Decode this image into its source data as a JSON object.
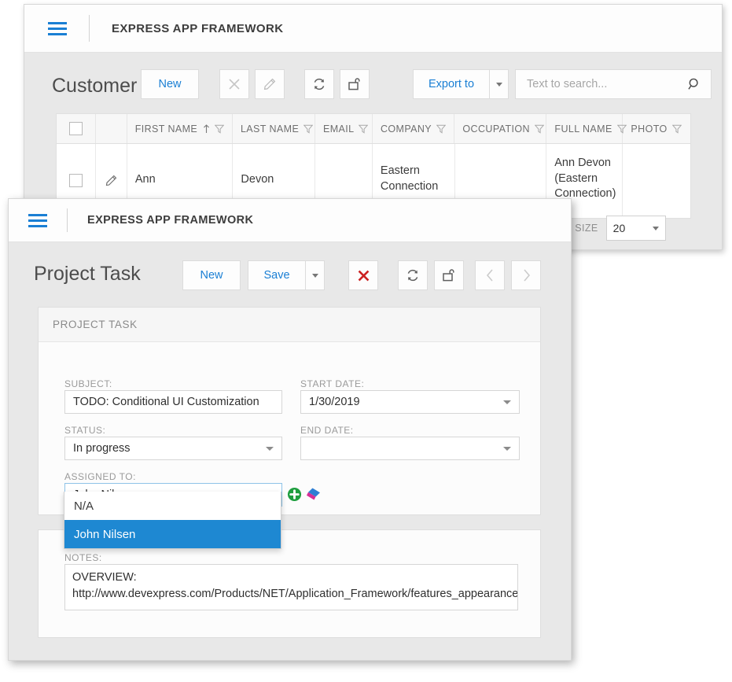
{
  "background_window": {
    "app_title": "EXPRESS APP FRAMEWORK",
    "menu_icon": "hamburger-icon",
    "page_title": "Customer",
    "toolbar": {
      "new_label": "New",
      "delete_icon": "close-x-icon",
      "edit_icon": "pencil-icon",
      "refresh_icon": "refresh-icon",
      "unlink_icon": "open-box-icon",
      "export_label": "Export to",
      "export_caret_icon": "chevron-down-icon",
      "search_placeholder": "Text to search...",
      "search_value": "",
      "search_icon": "magnifier-icon"
    },
    "grid": {
      "select_all_icon": "checkbox-icon",
      "columns": [
        {
          "label": "FIRST NAME",
          "sort": "asc",
          "sort_icon": "arrow-up-icon",
          "filter_icon": "funnel-icon"
        },
        {
          "label": "LAST NAME",
          "sort": "",
          "filter_icon": "funnel-icon"
        },
        {
          "label": "EMAIL",
          "sort": "",
          "filter_icon": "funnel-icon"
        },
        {
          "label": "COMPANY",
          "sort": "",
          "filter_icon": "funnel-icon"
        },
        {
          "label": "OCCUPATION",
          "sort": "",
          "filter_icon": "funnel-icon"
        },
        {
          "label": "FULL NAME",
          "sort": "",
          "filter_icon": "funnel-icon"
        },
        {
          "label": "PHOTO",
          "sort": "",
          "filter_icon": "funnel-icon"
        }
      ],
      "rows": [
        {
          "row_edit_icon": "pencil-icon",
          "first_name": "Ann",
          "last_name": "Devon",
          "email": "",
          "company": "Eastern Connection",
          "occupation": "",
          "full_name": "Ann Devon (Eastern Connection)",
          "photo": ""
        }
      ]
    },
    "pager": {
      "page_size_label": "PAGE SIZE",
      "page_size_value": "20",
      "page_size_caret_icon": "chevron-down-icon"
    }
  },
  "foreground_window": {
    "app_title": "EXPRESS APP FRAMEWORK",
    "menu_icon": "hamburger-icon",
    "page_title": "Project Task",
    "toolbar": {
      "new_label": "New",
      "save_label": "Save",
      "save_caret_icon": "chevron-down-icon",
      "delete_icon": "red-x-icon",
      "refresh_icon": "refresh-icon",
      "unlink_icon": "open-box-icon",
      "prev_icon": "chevron-left-icon",
      "next_icon": "chevron-right-icon"
    },
    "detail_panel": {
      "header": "PROJECT TASK",
      "fields": {
        "subject_label": "SUBJECT:",
        "subject_value": "TODO: Conditional UI Customization",
        "start_date_label": "START DATE:",
        "start_date_value": "1/30/2019",
        "start_date_caret_icon": "chevron-down-icon",
        "status_label": "STATUS:",
        "status_value": "In progress",
        "status_caret_icon": "chevron-down-icon",
        "end_date_label": "END DATE:",
        "end_date_value": "",
        "end_date_caret_icon": "chevron-down-icon",
        "assigned_to_label": "ASSIGNED TO:",
        "assigned_to_value": "John Nilsen",
        "assigned_to_caret_icon": "chevron-down-icon",
        "new_object_icon": "green-plus-icon",
        "clear_icon": "eraser-icon"
      },
      "dropdown": {
        "options": [
          {
            "label": "N/A",
            "selected": false
          },
          {
            "label": "John Nilsen",
            "selected": true
          }
        ]
      }
    },
    "notes_panel": {
      "notes_label": "NOTES:",
      "notes_line_1": "OVERVIEW:",
      "notes_line_2": "http://www.devexpress.com/Products/NET/Application_Framework/features_appearance.xml"
    }
  },
  "colors": {
    "accent_blue": "#1a7fd4",
    "selection_blue": "#1e88d2",
    "delete_red": "#cc2222",
    "chrome_gray": "#e8e8e8"
  }
}
